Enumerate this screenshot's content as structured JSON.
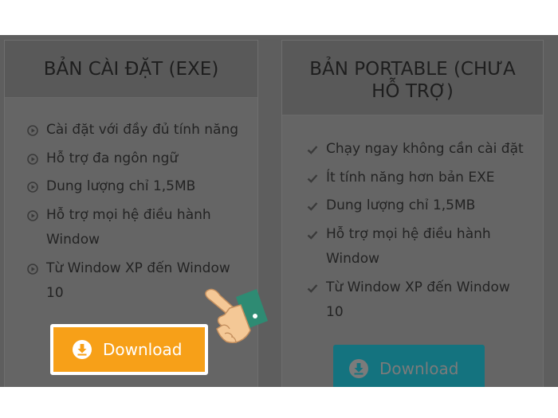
{
  "left_card": {
    "title": "BẢN CÀI ĐẶT (EXE)",
    "features": [
      {
        "text": "Cài đặt với đầy đủ tính năng",
        "icon": "circle-play-icon"
      },
      {
        "text": "Hỗ trợ đa ngôn ngữ",
        "icon": "circle-play-icon"
      },
      {
        "text": "Dung lượng chỉ 1,5MB",
        "icon": "circle-play-icon"
      },
      {
        "text": "Hỗ trợ mọi hệ điều hành Window",
        "icon": "circle-play-icon"
      },
      {
        "text": "Từ Window XP đến Window 10",
        "icon": "circle-play-icon"
      }
    ],
    "button_label": "Download",
    "button_color": "#f7a018"
  },
  "right_card": {
    "title": "BẢN PORTABLE (CHƯA HỖ TRỢ)",
    "features": [
      {
        "text": "Chạy ngay không cần cài đặt",
        "icon": "check-icon"
      },
      {
        "text": "Ít tính năng hơn bản EXE",
        "icon": "check-icon"
      },
      {
        "text": "Dung lượng chỉ 1,5MB",
        "icon": "check-icon"
      },
      {
        "text": "Hỗ trợ mọi hệ điều hành Window",
        "icon": "check-icon"
      },
      {
        "text": "Từ Window XP đến Window 10",
        "icon": "check-icon"
      }
    ],
    "button_label": "Download",
    "button_color": "#14737f"
  },
  "pointer": {
    "icon": "pointing-hand-icon"
  }
}
